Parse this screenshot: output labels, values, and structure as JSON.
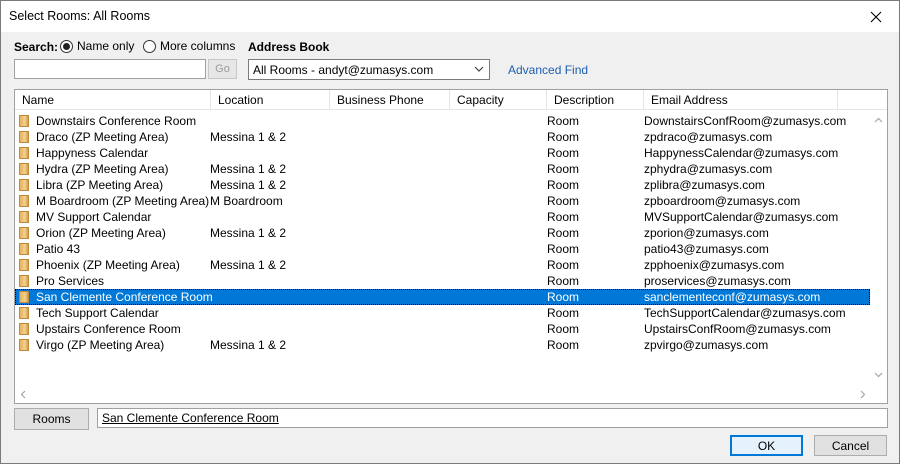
{
  "window": {
    "title": "Select Rooms: All Rooms"
  },
  "search": {
    "label": "Search:",
    "option_name_only": "Name only",
    "option_more_columns": "More columns",
    "input_value": "",
    "go_label": "Go"
  },
  "address_book": {
    "label": "Address Book",
    "selected": "All Rooms - andyt@zumasys.com",
    "advanced_find": "Advanced Find"
  },
  "columns": [
    "Name",
    "Location",
    "Business Phone",
    "Capacity",
    "Description",
    "Email Address"
  ],
  "rows": [
    {
      "name": "Downstairs Conference Room",
      "location": "",
      "phone": "",
      "capacity": "",
      "description": "Room",
      "email": "DownstairsConfRoom@zumasys.com"
    },
    {
      "name": "Draco (ZP Meeting Area)",
      "location": "Messina 1 & 2",
      "phone": "",
      "capacity": "",
      "description": "Room",
      "email": "zpdraco@zumasys.com"
    },
    {
      "name": "Happyness Calendar",
      "location": "",
      "phone": "",
      "capacity": "",
      "description": "Room",
      "email": "HappynessCalendar@zumasys.com"
    },
    {
      "name": "Hydra (ZP Meeting Area)",
      "location": "Messina 1 & 2",
      "phone": "",
      "capacity": "",
      "description": "Room",
      "email": "zphydra@zumasys.com"
    },
    {
      "name": "Libra (ZP Meeting Area)",
      "location": "Messina 1 & 2",
      "phone": "",
      "capacity": "",
      "description": "Room",
      "email": "zplibra@zumasys.com"
    },
    {
      "name": "M Boardroom (ZP Meeting Area)",
      "location": "M Boardroom",
      "phone": "",
      "capacity": "",
      "description": "Room",
      "email": "zpboardroom@zumasys.com"
    },
    {
      "name": "MV Support Calendar",
      "location": "",
      "phone": "",
      "capacity": "",
      "description": "Room",
      "email": "MVSupportCalendar@zumasys.com"
    },
    {
      "name": "Orion (ZP Meeting Area)",
      "location": "Messina 1 & 2",
      "phone": "",
      "capacity": "",
      "description": "Room",
      "email": "zporion@zumasys.com"
    },
    {
      "name": "Patio 43",
      "location": "",
      "phone": "",
      "capacity": "",
      "description": "Room",
      "email": "patio43@zumasys.com"
    },
    {
      "name": "Phoenix (ZP Meeting Area)",
      "location": "Messina 1 & 2",
      "phone": "",
      "capacity": "",
      "description": "Room",
      "email": "zpphoenix@zumasys.com"
    },
    {
      "name": "Pro Services",
      "location": "",
      "phone": "",
      "capacity": "",
      "description": "Room",
      "email": "proservices@zumasys.com"
    },
    {
      "name": "San Clemente Conference Room",
      "location": "",
      "phone": "",
      "capacity": "",
      "description": "Room",
      "email": "sanclementeconf@zumasys.com",
      "selected": true
    },
    {
      "name": "Tech Support Calendar",
      "location": "",
      "phone": "",
      "capacity": "",
      "description": "Room",
      "email": "TechSupportCalendar@zumasys.com"
    },
    {
      "name": "Upstairs Conference Room",
      "location": "",
      "phone": "",
      "capacity": "",
      "description": "Room",
      "email": "UpstairsConfRoom@zumasys.com"
    },
    {
      "name": "Virgo (ZP Meeting Area)",
      "location": "Messina 1 & 2",
      "phone": "",
      "capacity": "",
      "description": "Room",
      "email": "zpvirgo@zumasys.com"
    }
  ],
  "footer": {
    "rooms_button": "Rooms",
    "rooms_value": "San Clemente Conference Room",
    "ok_label": "OK",
    "cancel_label": "Cancel"
  },
  "colors": {
    "selection": "#0078d7",
    "link": "#1b5fb0",
    "accent_border": "#0078d7"
  }
}
